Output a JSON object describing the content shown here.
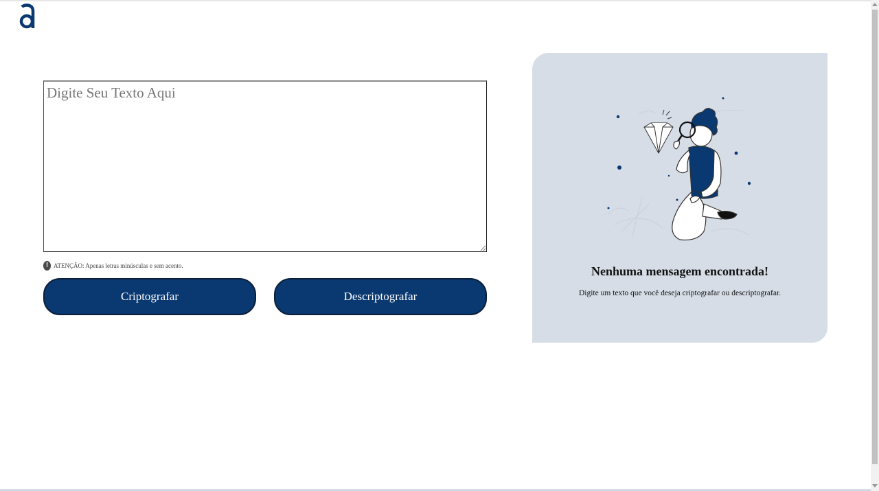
{
  "logo": {
    "icon": "alura-logo-icon",
    "color": "#0a3871"
  },
  "input": {
    "placeholder": "Digite Seu Texto Aqui",
    "value": ""
  },
  "warning": {
    "icon": "exclamation-circle-icon",
    "text": "ATENÇÃO: Apenas letras minúsculas e sem acento."
  },
  "buttons": {
    "encrypt_label": "Criptografar",
    "decrypt_label": "Descriptografar"
  },
  "output_panel": {
    "illustration": "person-with-magnifier-illustration",
    "title": "Nenhuma mensagem encontrada!",
    "subtitle": "Digite um texto que você deseja criptografar ou descriptografar."
  },
  "colors": {
    "accent": "#0a3871",
    "panel_bg": "#d7dde7"
  }
}
